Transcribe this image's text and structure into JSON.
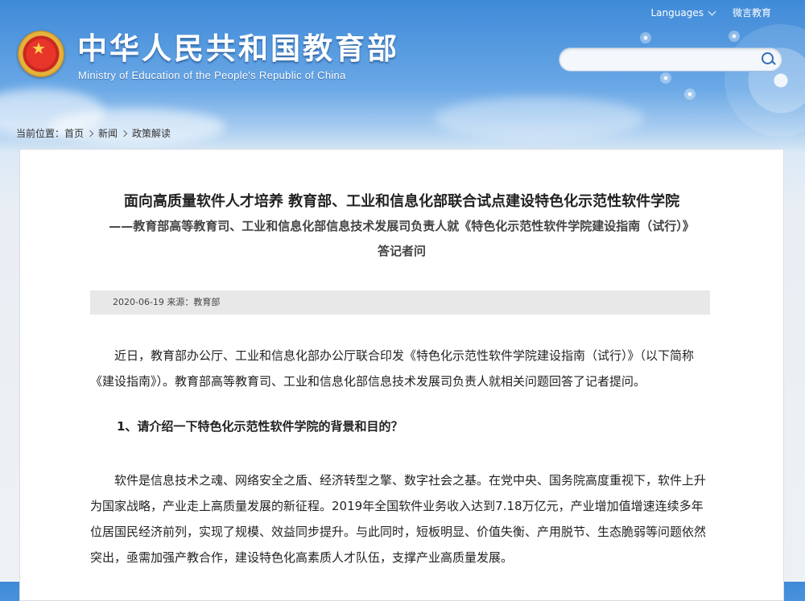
{
  "header": {
    "site_title": "中华人民共和国教育部",
    "site_subtitle": "Ministry of Education of the People's Republic of China",
    "languages_label": "Languages",
    "weibo_label": "微言教育",
    "search": {
      "placeholder": "",
      "value": ""
    }
  },
  "breadcrumb": {
    "prefix": "当前位置：",
    "items": [
      "首页",
      "新闻",
      "政策解读"
    ]
  },
  "article": {
    "title": "面向高质量软件人才培养 教育部、工业和信息化部联合试点建设特色化示范性软件学院",
    "subtitle_line1": "——教育部高等教育司、工业和信息化部信息技术发展司负责人就《特色化示范性软件学院建设指南（试行）》",
    "subtitle_line2": "答记者问",
    "meta": "2020-06-19 来源：教育部",
    "paragraphs": [
      "近日，教育部办公厅、工业和信息化部办公厅联合印发《特色化示范性软件学院建设指南（试行）》（以下简称《建设指南》）。教育部高等教育司、工业和信息化部信息技术发展司负责人就相关问题回答了记者提问。",
      "软件是信息技术之魂、网络安全之盾、经济转型之擎、数字社会之基。在党中央、国务院高度重视下，软件上升为国家战略，产业走上高质量发展的新征程。2019年全国软件业务收入达到7.18万亿元，产业增加值增速连续多年位居国民经济前列，实现了规模、效益同步提升。与此同时，短板明显、价值失衡、产用脱节、生态脆弱等问题依然突出，亟需加强产教合作，建设特色化高素质人才队伍，支撑产业高质量发展。"
    ],
    "question1": "1、请介绍一下特色化示范性软件学院的背景和目的？"
  }
}
